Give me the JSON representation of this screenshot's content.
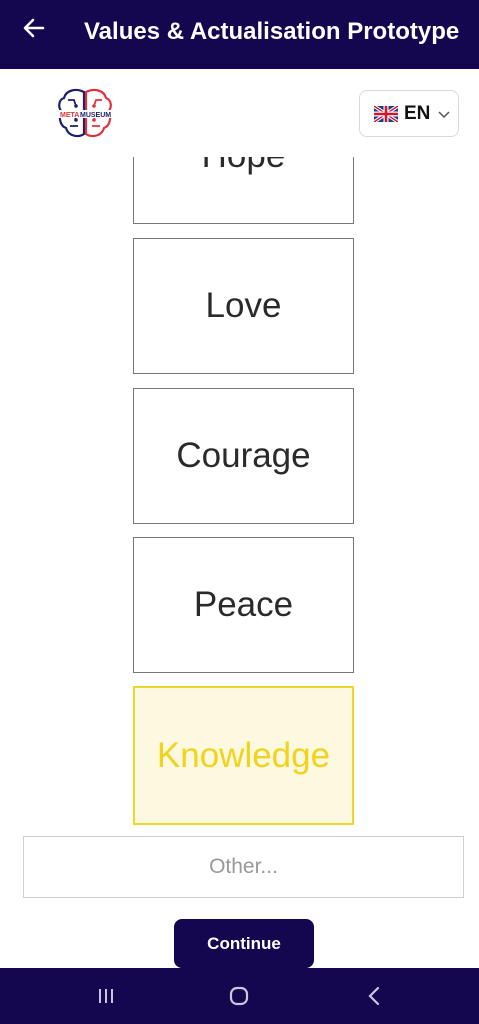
{
  "appbar": {
    "title": "Values & Actualisation Prototype",
    "back_icon": "arrow-left-icon",
    "background": "#14064f"
  },
  "header": {
    "logo_text_left": "META",
    "logo_text_right": "MUSEUM",
    "language": {
      "code": "EN",
      "flag_icon": "uk-flag-icon"
    }
  },
  "values": [
    {
      "label": "Hope",
      "selected": false
    },
    {
      "label": "Love",
      "selected": false
    },
    {
      "label": "Courage",
      "selected": false
    },
    {
      "label": "Peace",
      "selected": false
    },
    {
      "label": "Knowledge",
      "selected": true
    }
  ],
  "other": {
    "placeholder": "Other...",
    "value": ""
  },
  "continue_label": "Continue",
  "colors": {
    "primary": "#14064f",
    "selected_accent": "#f2d21a",
    "selected_bg": "#fdf9e0"
  },
  "navbar": {
    "icons": [
      "recent-apps-icon",
      "home-icon",
      "back-icon"
    ]
  }
}
